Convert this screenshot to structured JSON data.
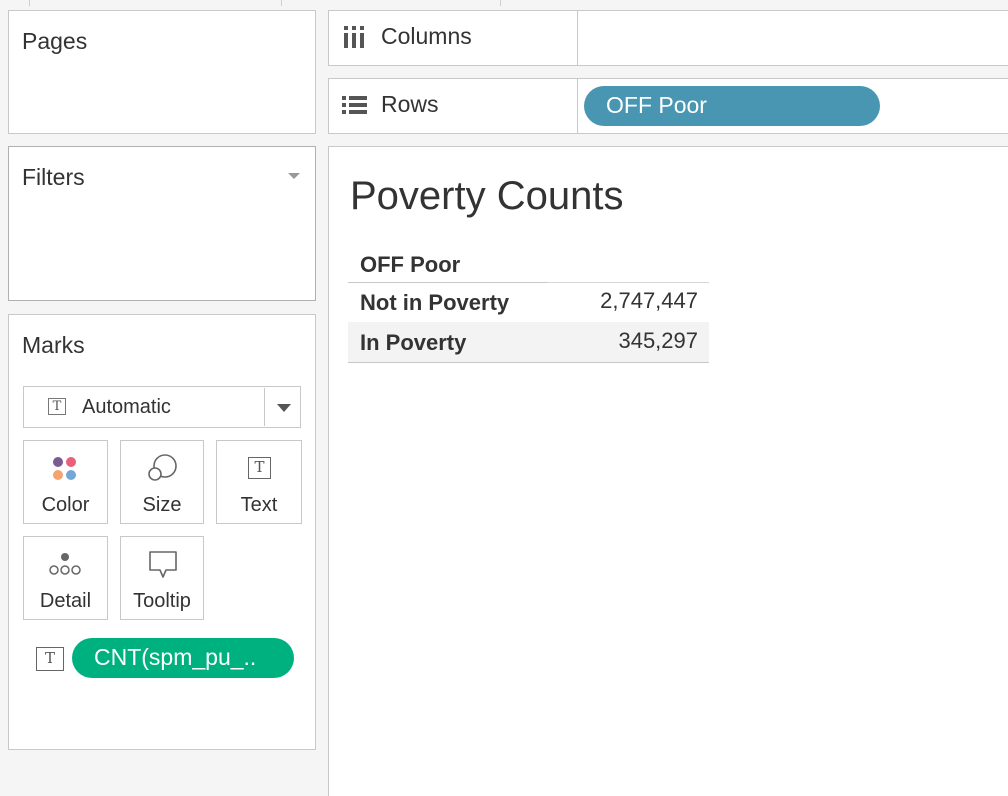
{
  "shelves": {
    "pages_label": "Pages",
    "filters_label": "Filters",
    "marks_label": "Marks",
    "columns_label": "Columns",
    "rows_label": "Rows",
    "rows_pill": "OFF Poor"
  },
  "marks": {
    "type": "Automatic",
    "cards": {
      "color": "Color",
      "size": "Size",
      "text": "Text",
      "detail": "Detail",
      "tooltip": "Tooltip"
    },
    "text_pill": "CNT(spm_pu_.."
  },
  "viz": {
    "title": "Poverty Counts",
    "row_header": "OFF Poor",
    "rows": [
      {
        "label": "Not in Poverty",
        "value": "2,747,447"
      },
      {
        "label": "In Poverty",
        "value": "345,297"
      }
    ]
  },
  "colors": {
    "dimension_pill": "#4996b2",
    "measure_pill": "#00b180",
    "color_dots": [
      "#7a5c91",
      "#e8607a",
      "#f4a46f",
      "#73a7d8"
    ]
  },
  "icons": {
    "columns": "columns-icon",
    "rows": "rows-icon",
    "filters_menu": "dropdown-caret-icon",
    "mark_type": "text-mark-icon",
    "color": "color-dots-icon",
    "size": "size-circles-icon",
    "text": "text-mark-icon",
    "detail": "detail-dots-icon",
    "tooltip": "tooltip-bubble-icon"
  }
}
